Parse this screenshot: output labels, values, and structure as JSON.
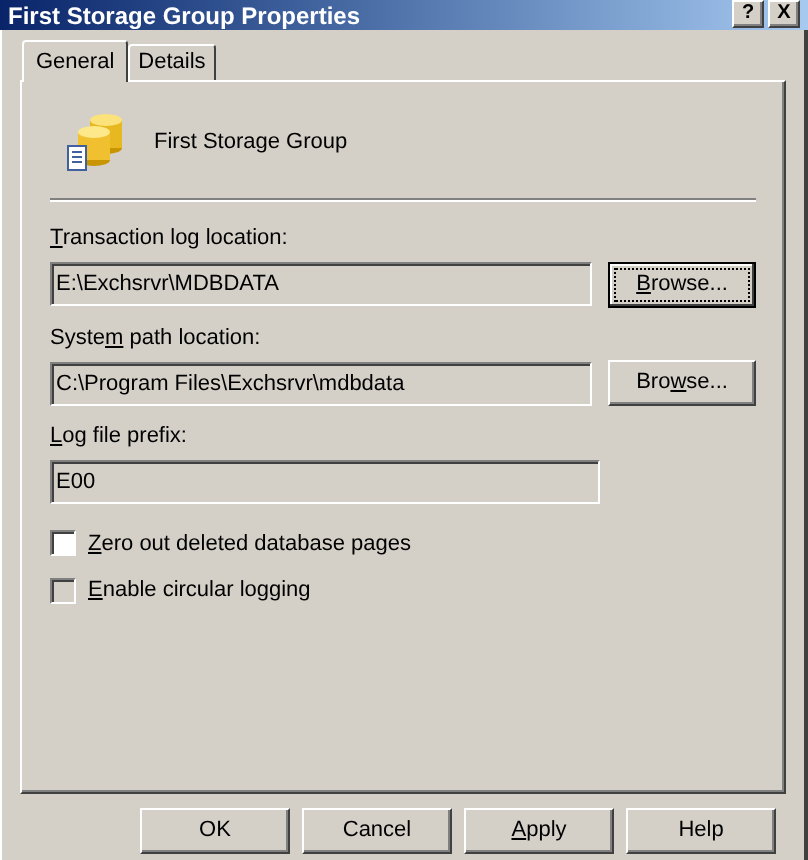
{
  "window": {
    "title": "First Storage Group Properties",
    "title_buttons": [
      "?",
      "X"
    ]
  },
  "tabs": [
    {
      "label": "General",
      "selected": true
    },
    {
      "label": "Details",
      "selected": false
    }
  ],
  "header": {
    "name": "First Storage Group"
  },
  "fields": [
    {
      "label": {
        "key": "T",
        "post": "ransaction log location:"
      },
      "value": "E:\\Exchsrvr\\MDBDATA",
      "button": {
        "key": "B",
        "post": "rowse...",
        "focused": true
      }
    },
    {
      "label": {
        "pre": "Syste",
        "key": "m",
        "post": " path location:"
      },
      "value": "C:\\Program Files\\Exchsrvr\\mdbdata",
      "button": {
        "pre": "Bro",
        "key": "w",
        "post": "se...",
        "focused": false
      }
    },
    {
      "label": {
        "key": "L",
        "post": "og file prefix:"
      },
      "value": "E00"
    }
  ],
  "checkboxes": [
    {
      "label": {
        "key": "Z",
        "post": "ero out deleted database pages"
      },
      "checked": false,
      "disabled": false
    },
    {
      "label": {
        "key": "E",
        "post": "nable circular logging"
      },
      "checked": false,
      "disabled": true
    }
  ],
  "buttons": [
    {
      "pre": "OK"
    },
    {
      "pre": "Cancel"
    },
    {
      "key": "A",
      "post": "pply"
    },
    {
      "pre": "Help"
    }
  ]
}
